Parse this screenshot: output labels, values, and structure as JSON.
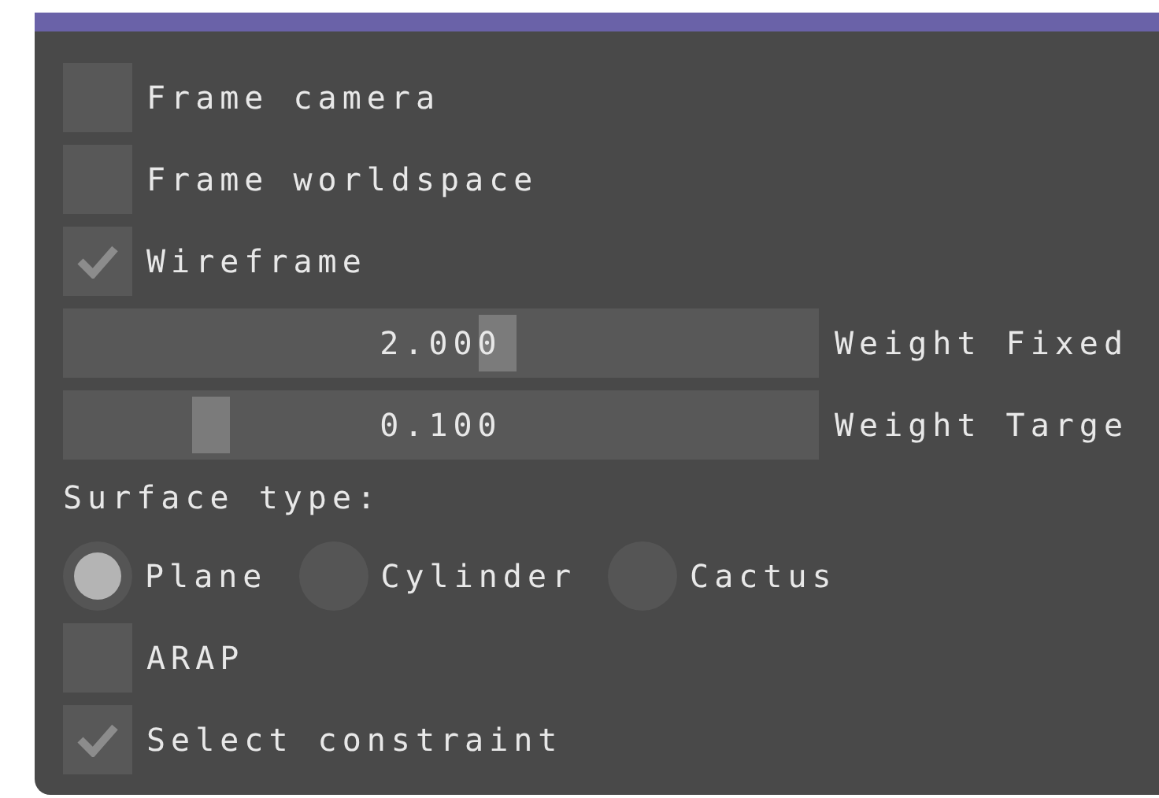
{
  "items": [
    {
      "kind": "checkbox",
      "label": "Frame camera",
      "checked": false
    },
    {
      "kind": "checkbox",
      "label": "Frame worldspace",
      "checked": false
    },
    {
      "kind": "checkbox",
      "label": "Wireframe",
      "checked": true
    },
    {
      "kind": "slider",
      "label": "Weight Fixed",
      "slider": {
        "value": "2.000",
        "level": 0.58
      }
    },
    {
      "kind": "slider",
      "label": "Weight Targe",
      "slider": {
        "value": "0.100",
        "level": 0.18
      }
    },
    {
      "kind": "text",
      "label": "Surface type:"
    },
    {
      "kind": "radio_group",
      "options": [
        {
          "label": "Plane",
          "selected": true
        },
        {
          "label": "Cylinder",
          "selected": false
        },
        {
          "label": "Cactus",
          "selected": false
        }
      ]
    },
    {
      "kind": "checkbox",
      "label": "ARAP",
      "checked": false
    },
    {
      "kind": "checkbox",
      "label": "Select constraint",
      "checked": true
    }
  ]
}
